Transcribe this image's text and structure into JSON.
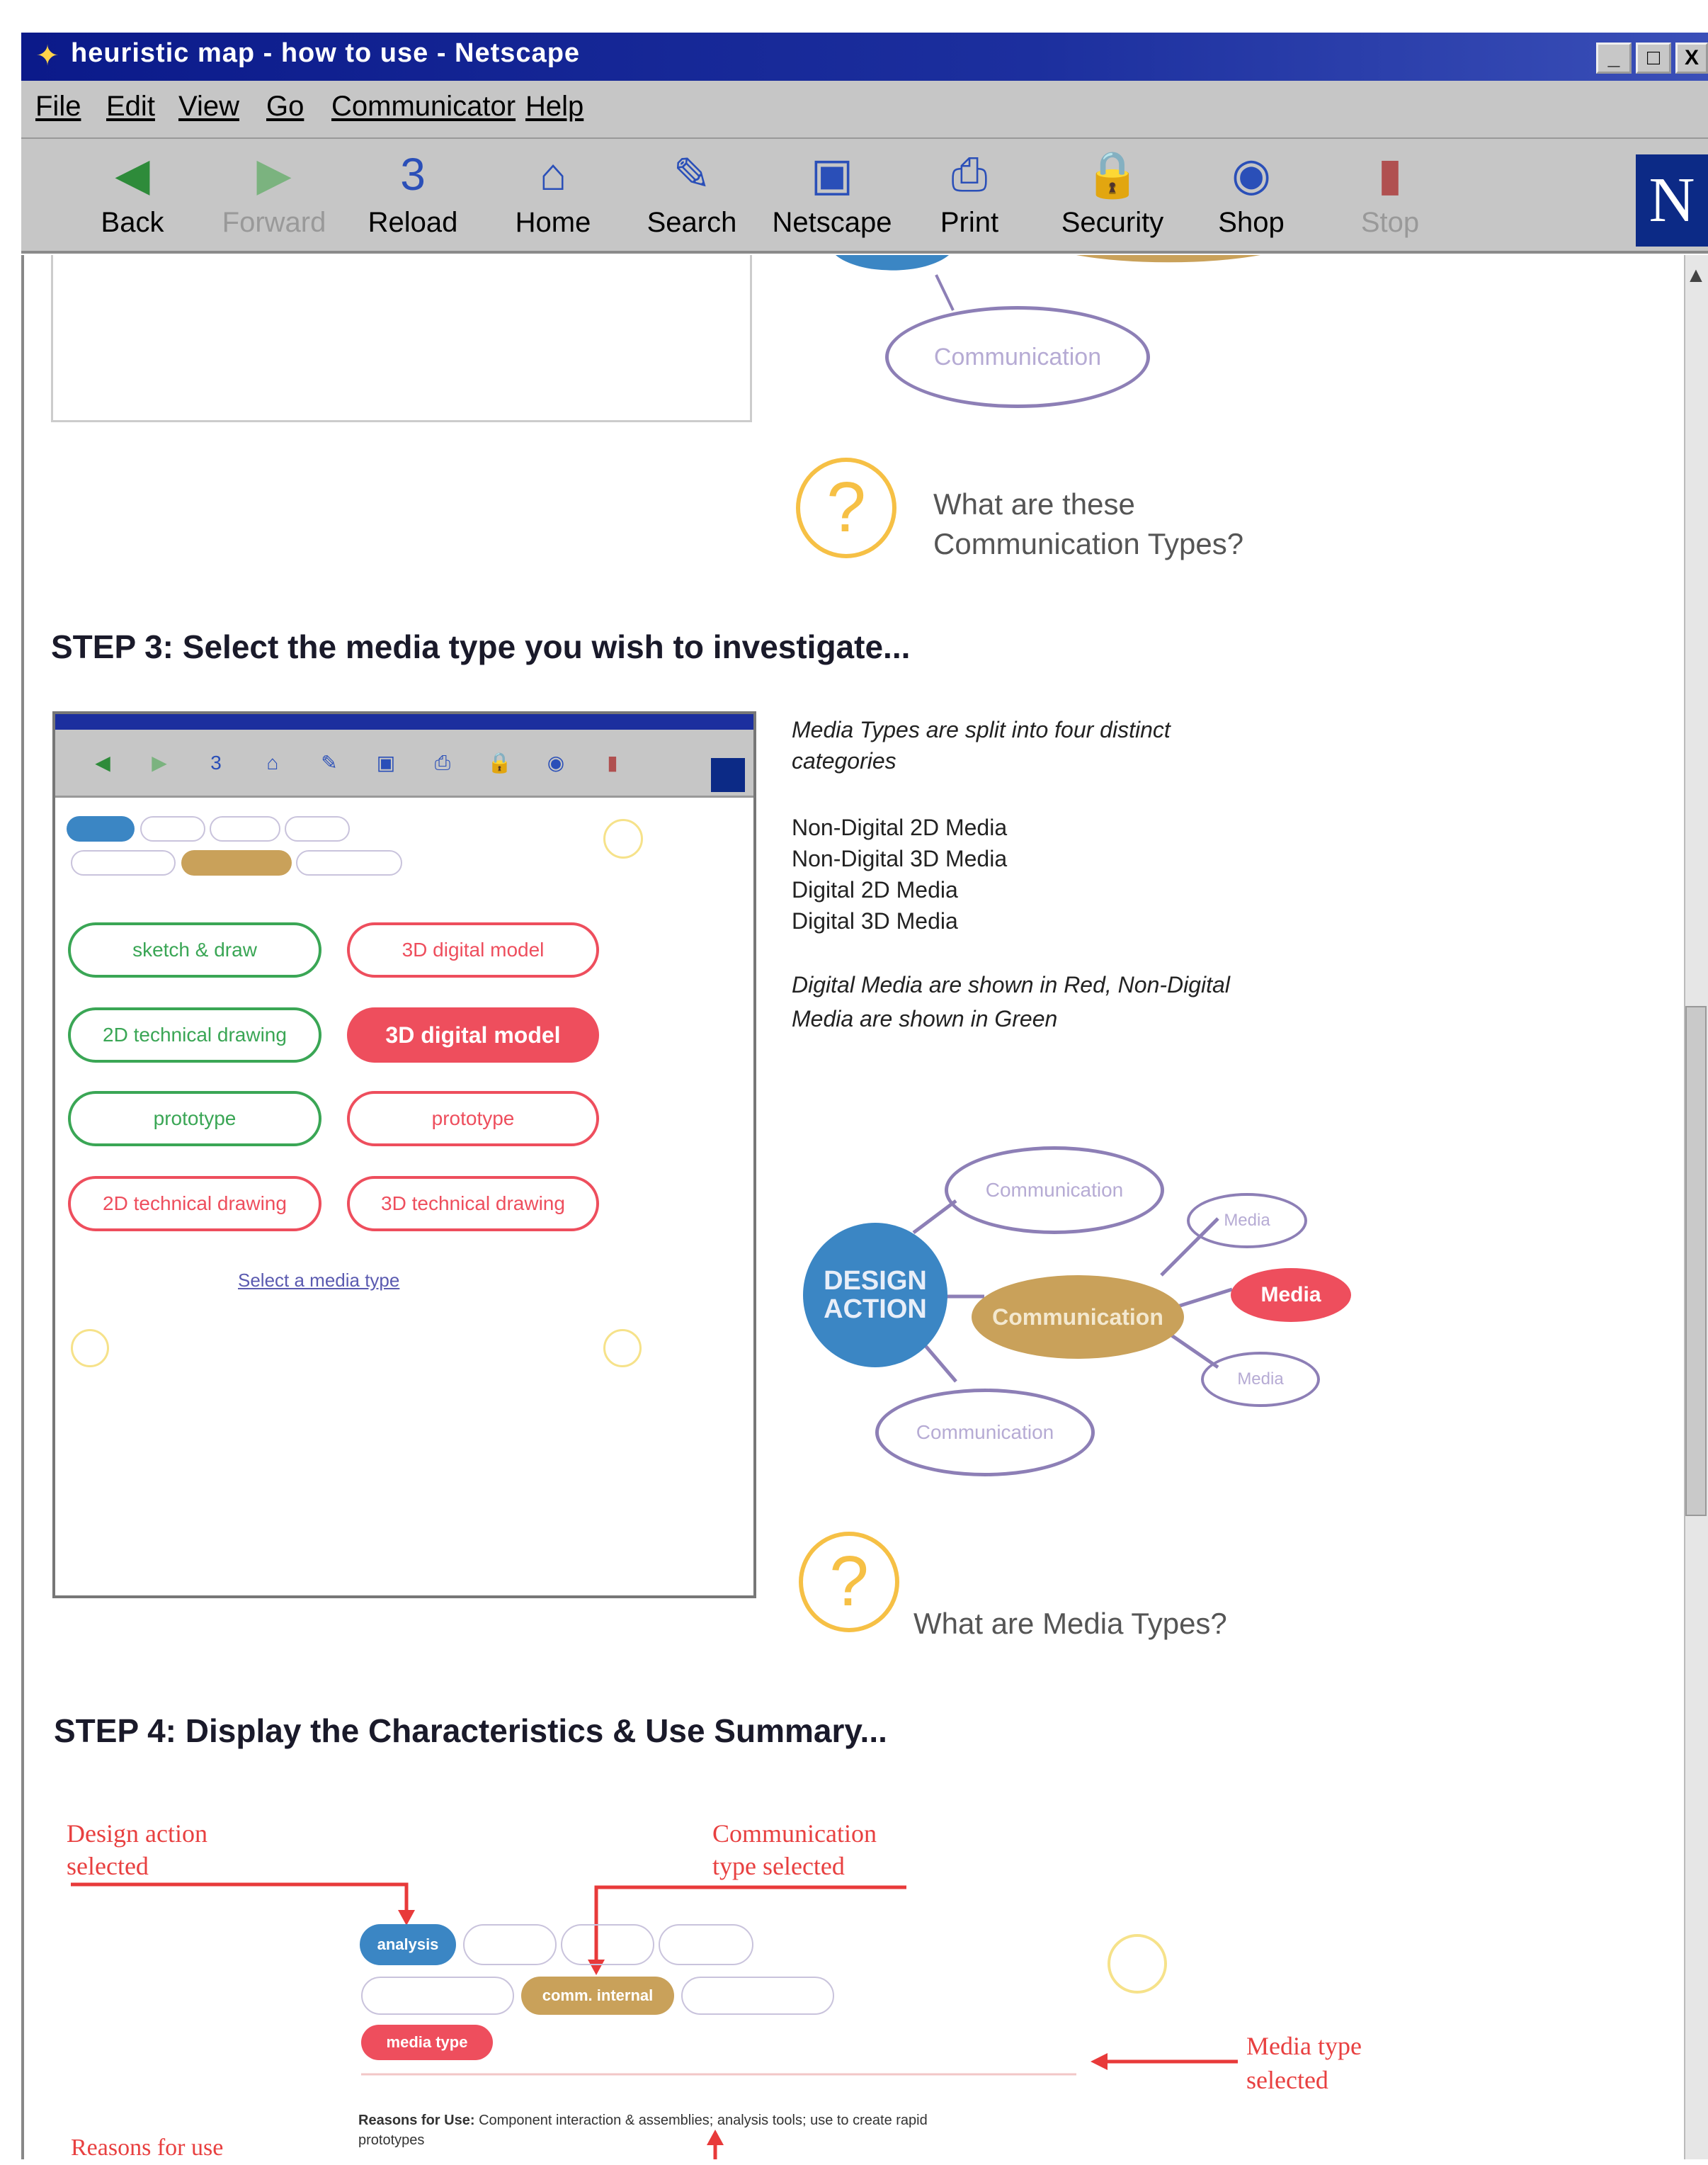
{
  "window": {
    "title": "heuristic map - how to use - Netscape",
    "controls": [
      "_",
      "□",
      "X"
    ]
  },
  "menu": [
    "File",
    "Edit",
    "View",
    "Go",
    "Communicator",
    "Help"
  ],
  "toolbar": [
    {
      "label": "Back",
      "icon": "back-arrow-icon",
      "glyph": "◀",
      "color": "#2e8b3a",
      "enabled": true
    },
    {
      "label": "Forward",
      "icon": "forward-arrow-icon",
      "glyph": "▶",
      "color": "#7bb37f",
      "enabled": false
    },
    {
      "label": "Reload",
      "icon": "reload-icon",
      "glyph": "3",
      "color": "#2a4fb8",
      "enabled": true
    },
    {
      "label": "Home",
      "icon": "home-icon",
      "glyph": "⌂",
      "color": "#2a4fb8",
      "enabled": true
    },
    {
      "label": "Search",
      "icon": "search-icon",
      "glyph": "✎",
      "color": "#2a4fb8",
      "enabled": true
    },
    {
      "label": "Netscape",
      "icon": "netscape-icon",
      "glyph": "▣",
      "color": "#2a4fb8",
      "enabled": true
    },
    {
      "label": "Print",
      "icon": "print-icon",
      "glyph": "⎙",
      "color": "#2a4fb8",
      "enabled": true
    },
    {
      "label": "Security",
      "icon": "security-lock-icon",
      "glyph": "🔒",
      "color": "#c0392b",
      "enabled": true
    },
    {
      "label": "Shop",
      "icon": "shop-icon",
      "glyph": "◉",
      "color": "#2a4fb8",
      "enabled": true
    },
    {
      "label": "Stop",
      "icon": "stop-icon",
      "glyph": "▮",
      "color": "#b05050",
      "enabled": false
    }
  ],
  "logo_letter": "N",
  "top": {
    "node": "Communication",
    "question": [
      "What are these",
      "Communication Types?"
    ],
    "q_glyph": "?"
  },
  "step3": {
    "heading": "STEP 3: Select the media type you wish to investigate...",
    "description": [
      "Media Types are split into four distinct",
      "categories"
    ],
    "types": [
      "Non-Digital 2D Media",
      "Non-Digital 3D Media",
      "Digital 2D Media",
      "Digital 3D Media"
    ],
    "note": [
      "Digital Media are shown in Red, Non-Digital",
      "Media are shown in Green"
    ],
    "mini": {
      "buttons_left": [
        "sketch & draw",
        "2D technical drawing",
        "prototype",
        "2D technical drawing"
      ],
      "buttons_right": [
        "3D digital model",
        "3D digital model",
        "prototype",
        "3D technical drawing"
      ],
      "link": "Select a media type"
    },
    "diagram": {
      "center": [
        "DESIGN",
        "ACTION"
      ],
      "mid": "Communication",
      "top": "Communication",
      "bottom": "Communication",
      "media_top": "Media",
      "media_red": "Media",
      "media_bottom": "Media"
    },
    "question": "What are Media Types?"
  },
  "step4": {
    "heading": "STEP 4: Display the Characteristics & Use Summary...",
    "label_design": [
      "Design action",
      "selected"
    ],
    "label_comm": [
      "Communication",
      "type selected"
    ],
    "label_media": [
      "Media type",
      "selected"
    ],
    "label_reasons": "Reasons for use",
    "reasons_bold": "Reasons for Use:",
    "reasons_text": "Component interaction & assemblies; analysis tools; use to create rapid",
    "reasons_text2": "prototypes",
    "pill_design": "analysis",
    "pill_comm": "comm. internal",
    "pill_media": "media type"
  },
  "colors": {
    "red": "#ee4e5d",
    "green": "#3aa655",
    "blue": "#3b86c4",
    "tan": "#c9a15a",
    "purple": "#8d7fb6",
    "yellow": "#f6c045",
    "arrow": "#e83a3a"
  }
}
